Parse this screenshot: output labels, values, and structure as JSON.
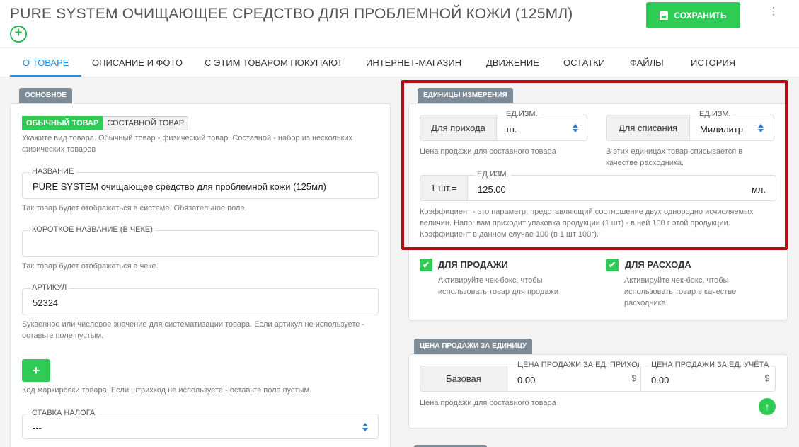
{
  "header": {
    "title": "PURE SYSTEM ОЧИЩАЮЩЕЕ СРЕДСТВО ДЛЯ ПРОБЛЕМНОЙ КОЖИ (125МЛ)",
    "add_icon": "+",
    "save_label": "СОХРАНИТЬ",
    "menu_icon": "⋮"
  },
  "tabs": [
    {
      "label": "О ТОВАРЕ",
      "active": true
    },
    {
      "label": "ОПИСАНИЕ И ФОТО"
    },
    {
      "label": "С ЭТИМ ТОВАРОМ ПОКУПАЮТ"
    },
    {
      "label": "ИНТЕРНЕТ-МАГАЗИН"
    },
    {
      "label": "ДВИЖЕНИЕ"
    },
    {
      "label": "ОСТАТКИ"
    },
    {
      "label": "ФАЙЛЫ"
    },
    {
      "label": "ИСТОРИЯ"
    }
  ],
  "basic": {
    "tag": "ОСНОВНОЕ",
    "type_simple": "ОБЫЧНЫЙ ТОВАР",
    "type_compound": "СОСТАВНОЙ ТОВАР",
    "type_hint": "Укажите вид товара. Обычный товар - физический товар. Составной - набор из нескольких физических товаров",
    "name_label": "НАЗВАНИЕ",
    "name_value": "PURE SYSTEM очищающее средство для проблемной кожи (125мл)",
    "name_hint": "Так товар будет отображаться в системе. Обязательное поле.",
    "short_label": "КОРОТКОЕ НАЗВАНИЕ (В ЧЕКЕ)",
    "short_value": "",
    "short_hint": "Так товар будет отображаться в чеке.",
    "sku_label": "АРТИКУЛ",
    "sku_value": "52324",
    "sku_hint": "Буквенное или числовое значение для систематизации товара. Если артикул не используете - оставьте поле пустым.",
    "barcode_add": "+",
    "barcode_hint": "Код маркировки товара. Если штрихкод не используете - оставьте поле пустым.",
    "tax_label": "СТАВКА НАЛОГА",
    "tax_value": "---"
  },
  "units": {
    "tag": "ЕДИНИЦЫ ИЗМЕРЕНИЯ",
    "income_addon": "Для прихода",
    "income_label": "ЕД.ИЗМ.",
    "income_value": "шт.",
    "income_hint": "Цена продажи для составного товара",
    "writeoff_addon": "Для списания",
    "writeoff_label": "ЕД.ИЗМ.",
    "writeoff_value": "Милилитр",
    "writeoff_hint": "В этих единицах товар списывается в качестве расходника.",
    "coef_addon": "1 шт.=",
    "coef_label": "ЕД.ИЗМ.",
    "coef_value": "125.00",
    "coef_unit": "мл.",
    "coef_hint": "Коэффициент - это параметр, представляющий соотношение двух однородно исчисляемых величин. Напр: вам приходит упаковка продукции (1 шт) - в ней 100 г этой продукции. Коэффициент в данном случае 100 (в 1 шт 100г).",
    "sale_label": "ДЛЯ ПРОДАЖИ",
    "sale_hint": "Активируйте чек-бокс, чтобы использовать товар для продажи",
    "expense_label": "ДЛЯ РАСХОДА",
    "expense_hint": "Активируйте чек-бокс, чтобы использовать товар в качестве расходника",
    "check_icon": "✔"
  },
  "price": {
    "tag": "ЦЕНА ПРОДАЖИ ЗА ЕДИНИЦУ",
    "base_addon": "Базовая",
    "income_label": "ЦЕНА ПРОДАЖИ ЗА ЕД. ПРИХОДА",
    "income_value": "0.00",
    "income_currency": "$",
    "account_label": "ЦЕНА ПРОДАЖИ ЗА ЕД. УЧЁТА",
    "account_value": "0.00",
    "account_currency": "$",
    "hint": "Цена продажи для составного товара",
    "up_icon": "↑"
  },
  "colors": {
    "accent": "#2ecc55",
    "tab_active": "#2a8fd6",
    "highlight": "#b30d16",
    "tag": "#7d8b97"
  }
}
